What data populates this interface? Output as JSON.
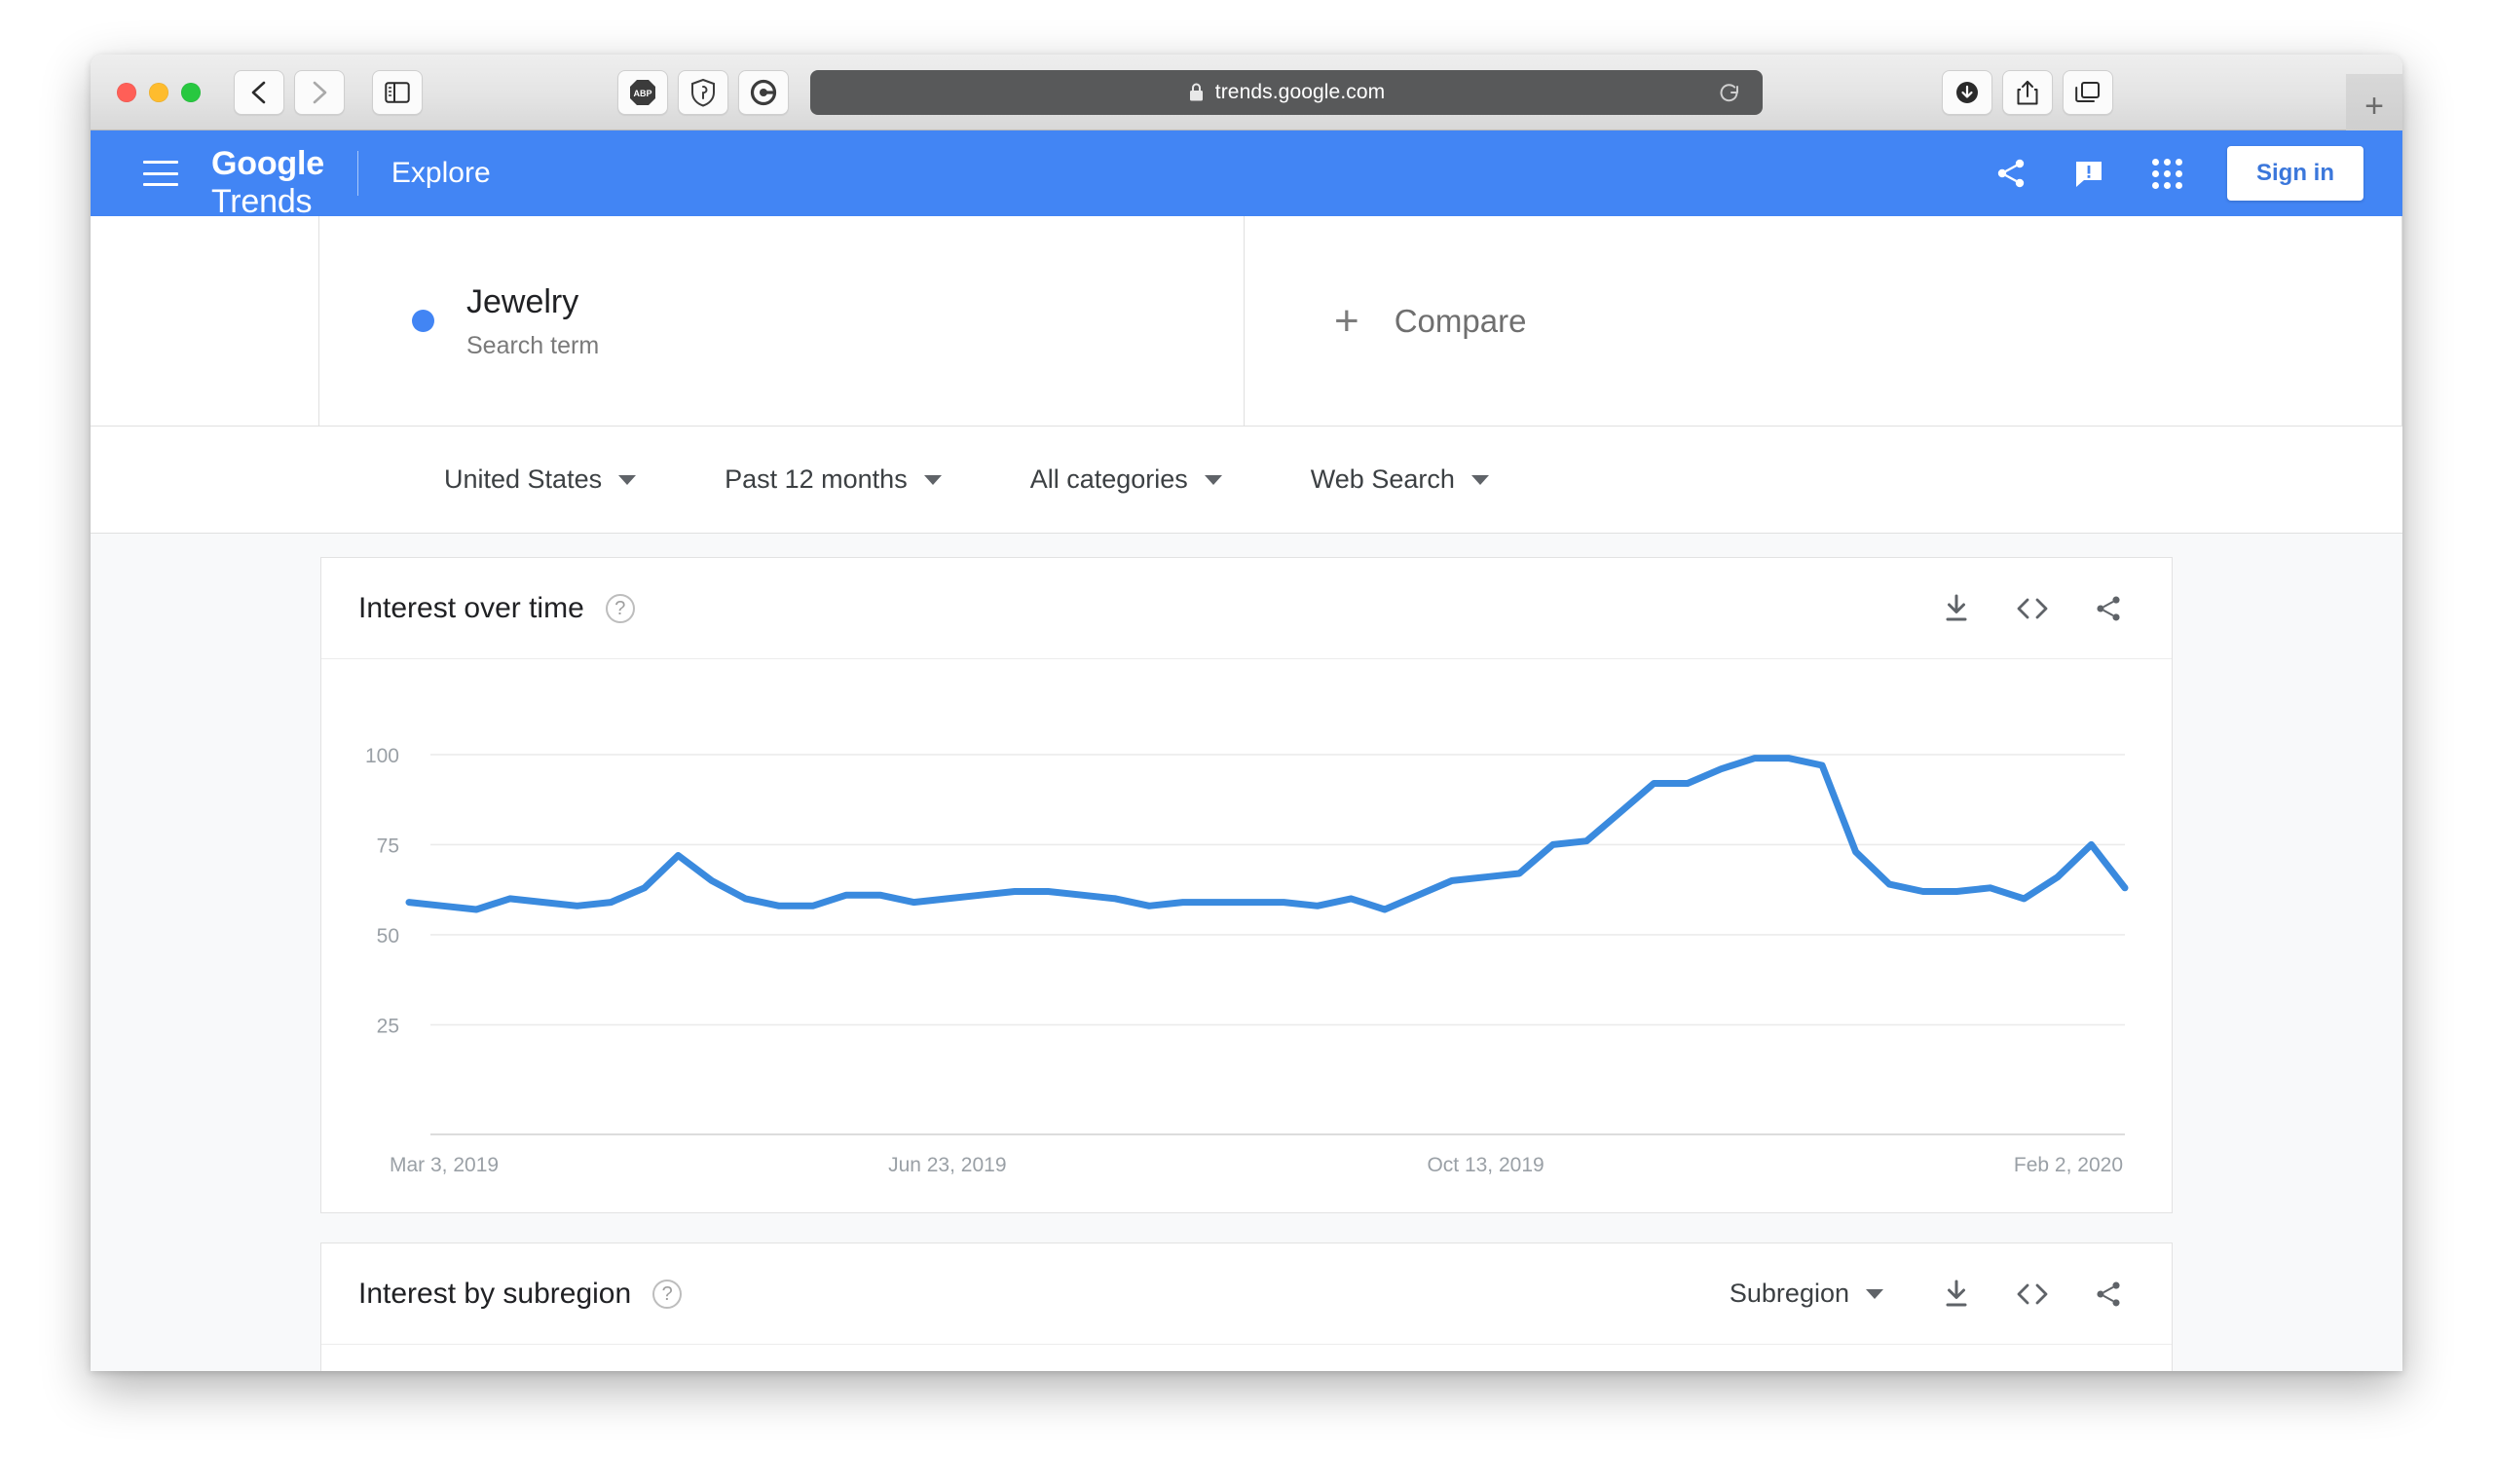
{
  "browser": {
    "url": "trends.google.com",
    "lock_icon": "lock-icon",
    "reload_icon": "reload-icon",
    "back_icon": "back-chevron-icon",
    "forward_icon": "forward-chevron-icon",
    "sidebar_icon": "sidebar-toggle-icon",
    "extensions": [
      {
        "name": "adblock-plus-extension-icon",
        "label": "ABP"
      },
      {
        "name": "shield-extension-icon",
        "label": ""
      },
      {
        "name": "grammarly-extension-icon",
        "label": "G"
      }
    ],
    "right_buttons": [
      {
        "name": "downloads-button-icon"
      },
      {
        "name": "share-button-icon"
      },
      {
        "name": "tab-overview-button-icon"
      }
    ],
    "new_tab_label": "+"
  },
  "header": {
    "menu_icon": "hamburger-menu-icon",
    "logo_bold": "Google",
    "logo_light": "Trends",
    "nav_label": "Explore",
    "share_icon": "share-icon",
    "feedback_icon": "feedback-icon",
    "apps_icon": "apps-grid-icon",
    "sign_in_label": "Sign in"
  },
  "term": {
    "dot_color": "#4285f4",
    "title": "Jewelry",
    "subtitle": "Search term",
    "compare_plus": "+",
    "compare_label": "Compare"
  },
  "filters": [
    {
      "label": "United States",
      "name": "filter-location"
    },
    {
      "label": "Past 12 months",
      "name": "filter-time-range"
    },
    {
      "label": "All categories",
      "name": "filter-category"
    },
    {
      "label": "Web Search",
      "name": "filter-search-type"
    }
  ],
  "cards": {
    "interest_over_time": {
      "title": "Interest over time",
      "help": "?",
      "actions": [
        {
          "name": "download-csv-icon"
        },
        {
          "name": "embed-code-icon"
        },
        {
          "name": "share-chart-icon"
        }
      ]
    },
    "interest_by_subregion": {
      "title": "Interest by subregion",
      "help": "?",
      "dropdown_label": "Subregion",
      "actions": [
        {
          "name": "download-csv-icon"
        },
        {
          "name": "embed-code-icon"
        },
        {
          "name": "share-chart-icon"
        }
      ]
    }
  },
  "chart_data": {
    "type": "line",
    "title": "Interest over time",
    "xlabel": "",
    "ylabel": "",
    "series_name": "Jewelry",
    "line_color": "#3a8ade",
    "grid": true,
    "legend_position": "none",
    "ylim": [
      0,
      107
    ],
    "yticks": [
      25,
      50,
      75,
      100
    ],
    "ytick_labels": [
      "25",
      "50",
      "75",
      "100"
    ],
    "xtick_labels": [
      "Mar 3, 2019",
      "Jun 23, 2019",
      "Oct 13, 2019",
      "Feb 2, 2020"
    ],
    "xtick_indices": [
      0,
      16,
      32,
      48
    ],
    "x": [
      "Mar 3, 2019",
      "Mar 10, 2019",
      "Mar 17, 2019",
      "Mar 24, 2019",
      "Mar 31, 2019",
      "Apr 7, 2019",
      "Apr 14, 2019",
      "Apr 21, 2019",
      "Apr 28, 2019",
      "May 5, 2019",
      "May 12, 2019",
      "May 19, 2019",
      "May 26, 2019",
      "Jun 2, 2019",
      "Jun 9, 2019",
      "Jun 16, 2019",
      "Jun 23, 2019",
      "Jun 30, 2019",
      "Jul 7, 2019",
      "Jul 14, 2019",
      "Jul 21, 2019",
      "Jul 28, 2019",
      "Aug 4, 2019",
      "Aug 11, 2019",
      "Aug 18, 2019",
      "Aug 25, 2019",
      "Sep 1, 2019",
      "Sep 8, 2019",
      "Sep 15, 2019",
      "Sep 22, 2019",
      "Sep 29, 2019",
      "Oct 6, 2019",
      "Oct 13, 2019",
      "Oct 20, 2019",
      "Oct 27, 2019",
      "Nov 3, 2019",
      "Nov 10, 2019",
      "Nov 17, 2019",
      "Nov 24, 2019",
      "Dec 1, 2019",
      "Dec 8, 2019",
      "Dec 15, 2019",
      "Dec 22, 2019",
      "Dec 29, 2019",
      "Jan 5, 2020",
      "Jan 12, 2020",
      "Jan 19, 2020",
      "Jan 26, 2020",
      "Feb 2, 2020",
      "Feb 9, 2020",
      "Feb 16, 2020",
      "Feb 23, 2020"
    ],
    "values": [
      59,
      58,
      57,
      60,
      59,
      58,
      59,
      63,
      72,
      65,
      60,
      58,
      58,
      61,
      61,
      59,
      60,
      61,
      62,
      62,
      61,
      60,
      58,
      59,
      59,
      59,
      59,
      58,
      60,
      57,
      61,
      65,
      66,
      67,
      75,
      76,
      84,
      92,
      92,
      96,
      99,
      99,
      97,
      73,
      64,
      62,
      62,
      63,
      60,
      66,
      75,
      63
    ]
  }
}
